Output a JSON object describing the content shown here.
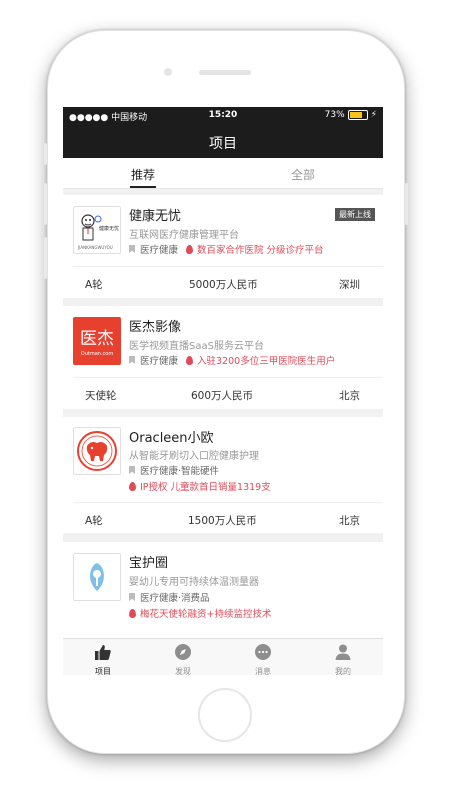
{
  "status_bar": {
    "carrier": "●●●●● 中国移动",
    "time": "15:20",
    "battery": "73%"
  },
  "nav": {
    "title": "项目"
  },
  "tabs": [
    {
      "label": "推荐",
      "active": true
    },
    {
      "label": "全部",
      "active": false
    }
  ],
  "projects": [
    {
      "name": "健康无忧",
      "desc": "互联网医疗健康管理平台",
      "category": "医疗健康",
      "highlight": "数百家合作医院 分级诊疗平台",
      "badge": "最新上线",
      "logo_text": "健康无忧",
      "logo_subtext": "JIANKANGWUYOU",
      "round": "A轮",
      "amount": "5000万人民币",
      "city": "深圳"
    },
    {
      "name": "医杰影像",
      "desc": "医学视频直播SaaS服务云平台",
      "category": "医疗健康",
      "highlight": "入驻3200多位三甲医院医生用户",
      "logo_text": "医杰",
      "logo_subtext": "Outman.com",
      "round": "天使轮",
      "amount": "600万人民币",
      "city": "北京"
    },
    {
      "name": "Oracleen小欧",
      "desc": "从智能牙刷切入口腔健康护理",
      "category": "医疗健康·智能硬件",
      "highlight": "IP授权 儿童款首日销量1319支",
      "round": "A轮",
      "amount": "1500万人民币",
      "city": "北京"
    },
    {
      "name": "宝护圈",
      "desc": "婴幼儿专用可持续体温测量器",
      "category": "医疗健康·消费品",
      "highlight": "梅花天使轮融资+持续监控技术"
    }
  ],
  "tab_bar": [
    {
      "label": "项目",
      "icon": "thumbs-up-icon",
      "active": true
    },
    {
      "label": "发现",
      "icon": "compass-icon",
      "active": false
    },
    {
      "label": "消息",
      "icon": "chat-bubble-icon",
      "active": false
    },
    {
      "label": "我的",
      "icon": "person-icon",
      "active": false
    }
  ],
  "colors": {
    "dark_bar": "#1c1c1c",
    "highlight": "#e04b5a",
    "logo_red": "#e8402f",
    "battery": "#f7c51b"
  }
}
